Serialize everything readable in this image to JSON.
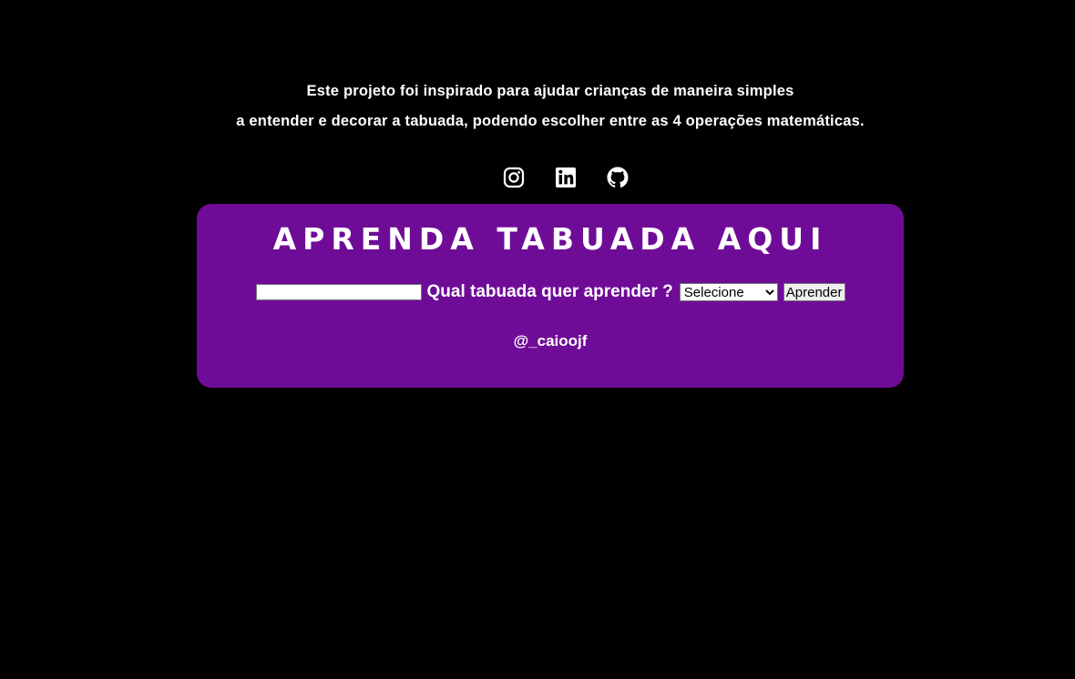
{
  "intro": {
    "line1": "Este projeto foi inspirado para ajudar crianças de maneira simples",
    "line2": "a entender e decorar a tabuada, podendo escolher entre as 4 operações matemáticas."
  },
  "social": {
    "links": [
      {
        "name": "instagram",
        "icon": "instagram-icon"
      },
      {
        "name": "linkedin",
        "icon": "linkedin-icon"
      },
      {
        "name": "github",
        "icon": "github-icon"
      }
    ]
  },
  "card": {
    "title": "Aprenda Tabuada Aqui",
    "background": "#6f0c97",
    "number_input_value": "",
    "question_label": "Qual tabuada quer aprender ?",
    "operation_select": {
      "selected": "Selecione"
    },
    "submit_label": "Aprender",
    "handle": "@_caioojf"
  }
}
